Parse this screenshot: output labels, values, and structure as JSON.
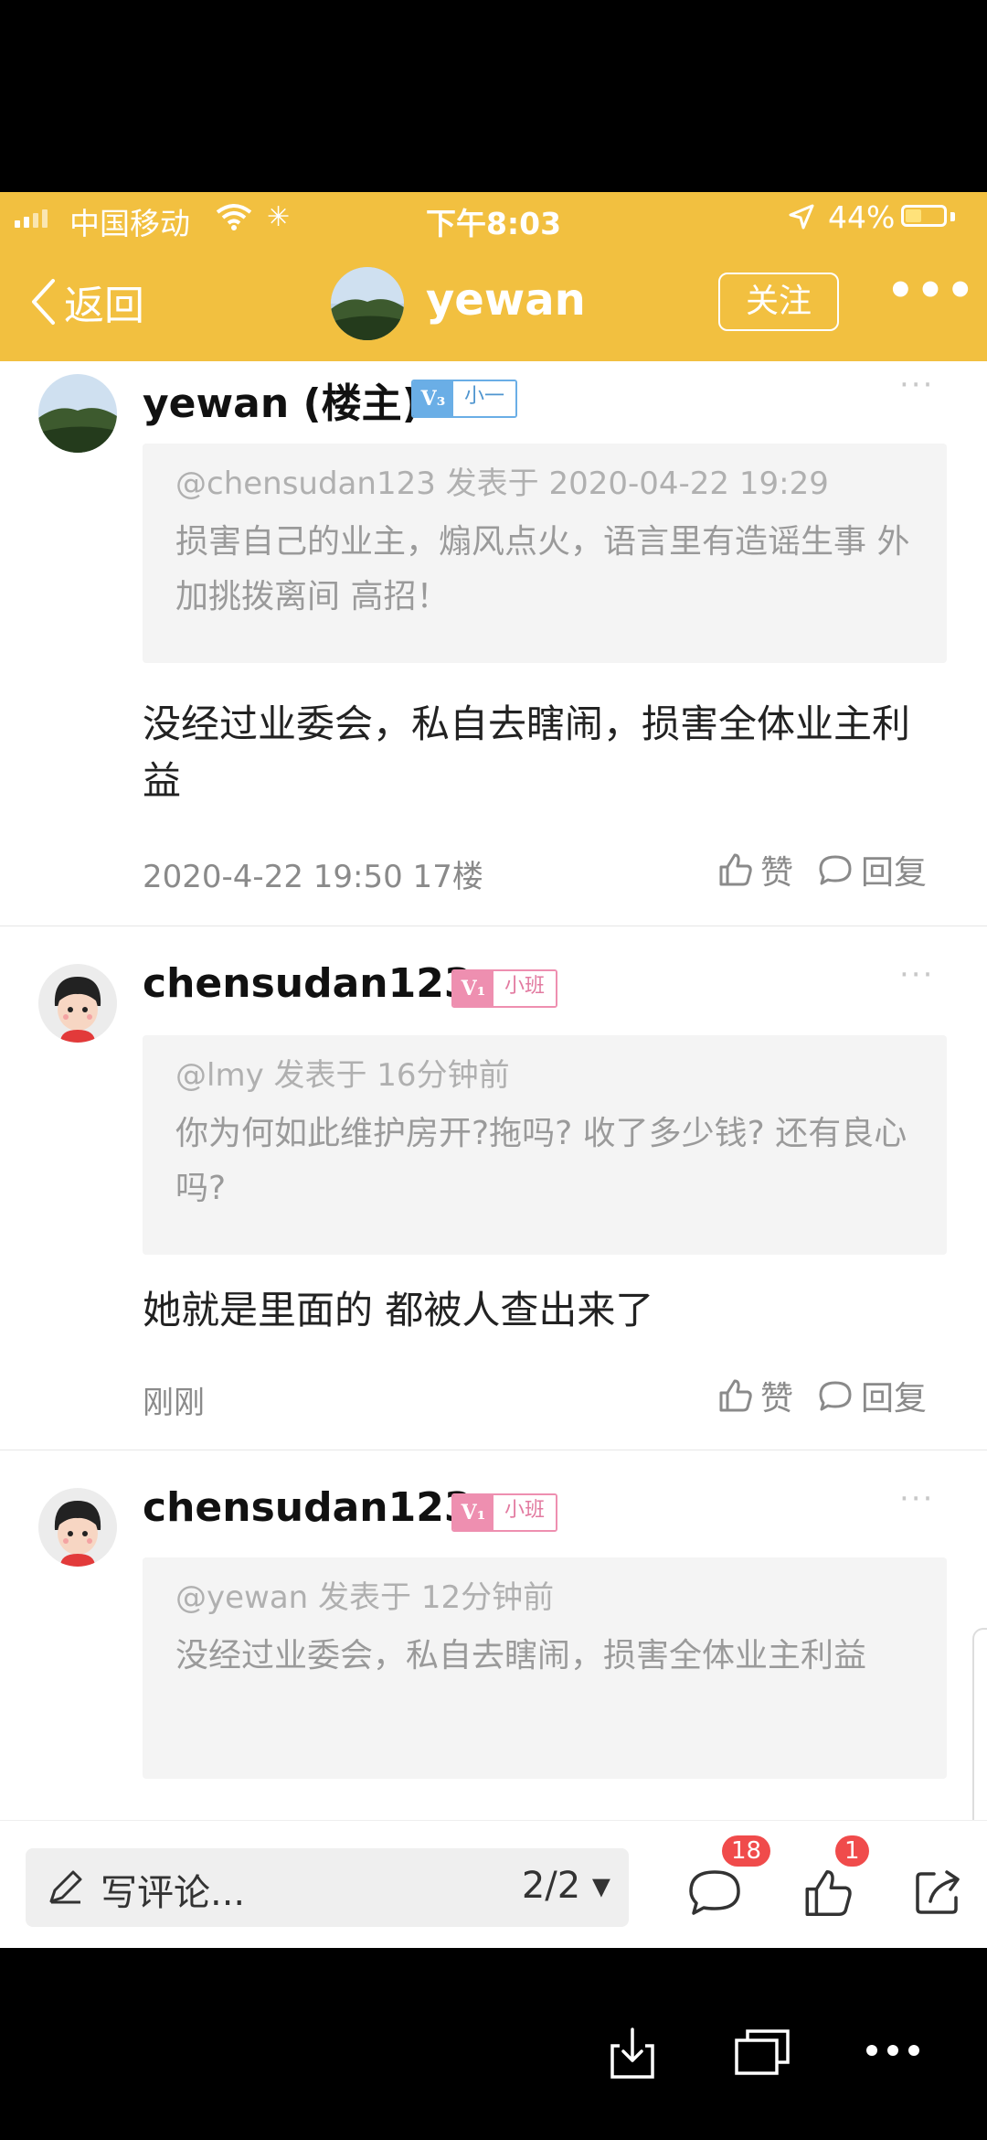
{
  "status_bar": {
    "carrier": "中国移动",
    "time": "下午8:03",
    "battery_pct": "44%",
    "battery_level": 0.44
  },
  "nav": {
    "back_label": "返回",
    "username": "yewan",
    "follow_label": "关注",
    "more": "•••"
  },
  "comments": [
    {
      "name": "yewan (楼主)",
      "badge_level": "V₃",
      "badge_text": "小一",
      "quote_header": "@chensudan123 发表于 2020-04-22 19:29",
      "quote_body": "损害自己的业主，煽风点火，语言里有造谣生事 外加挑拨离间  高招！",
      "body": "没经过业委会，私自去瞎闹，损害全体业主利益",
      "meta": "2020-4-22 19:50  17楼",
      "like_label": "赞",
      "reply_label": "回复"
    },
    {
      "name": "chensudan123",
      "badge_level": "V₁",
      "badge_text": "小班",
      "quote_header": "@lmy 发表于 16分钟前",
      "quote_body": "你为何如此维护房开?拖吗? 收了多少钱? 还有良心吗?",
      "body": "她就是里面的 都被人查出来了",
      "meta": "刚刚",
      "like_label": "赞",
      "reply_label": "回复"
    },
    {
      "name": "chensudan123",
      "badge_level": "V₁",
      "badge_text": "小班",
      "quote_header": "@yewan 发表于 12分钟前",
      "quote_body": "没经过业委会，私自去瞎闹，损害全体业主利益"
    }
  ],
  "bottom_bar": {
    "write_placeholder": "写评论...",
    "page_indicator": "2/2 ▾",
    "comment_count": "18",
    "like_count": "1"
  },
  "colors": {
    "header_bg": "#f2c040",
    "badge_blue": "#6aaee6",
    "badge_pink": "#ee8fb0",
    "count_badge": "#f04b4b"
  }
}
